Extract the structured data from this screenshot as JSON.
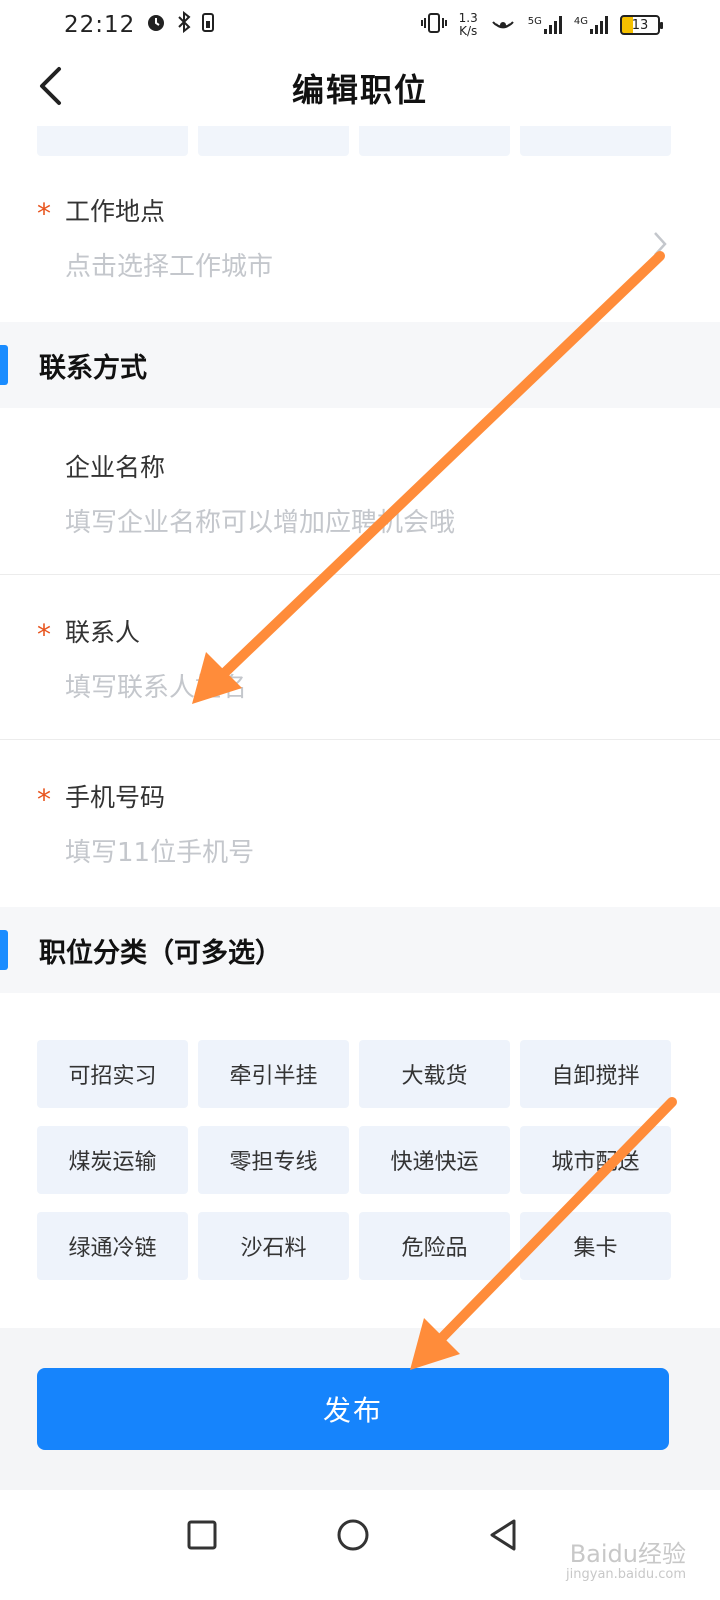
{
  "status_bar": {
    "time": "22:12",
    "net_speed_value": "1.3",
    "net_speed_unit": "K/s",
    "sig1_label": "5G",
    "sig2_label": "4G",
    "battery": "13"
  },
  "header": {
    "title": "编辑职位",
    "back_icon": "chevron-left-icon"
  },
  "fields": {
    "work_location": {
      "label": "工作地点",
      "placeholder": "点击选择工作城市",
      "required": true
    },
    "company_name": {
      "label": "企业名称",
      "placeholder": "填写企业名称可以增加应聘机会哦",
      "required": false
    },
    "contact_person": {
      "label": "联系人",
      "placeholder": "填写联系人姓名",
      "required": true
    },
    "phone": {
      "label": "手机号码",
      "placeholder": "填写11位手机号",
      "required": true
    },
    "required_mark": "*"
  },
  "sections": {
    "contact": "联系方式",
    "category": "职位分类（可多选）"
  },
  "categories": [
    "可招实习",
    "牵引半挂",
    "大载货",
    "自卸搅拌",
    "煤炭运输",
    "零担专线",
    "快递快运",
    "城市配送",
    "绿通冷链",
    "沙石料",
    "危险品",
    "集卡"
  ],
  "publish_label": "发布",
  "watermark": {
    "main": "Baidu经验",
    "sub": "jingyan.baidu.com"
  },
  "colors": {
    "accent": "#1684fc",
    "required": "#e8541e",
    "annotation_arrow": "#ff8c3a"
  }
}
